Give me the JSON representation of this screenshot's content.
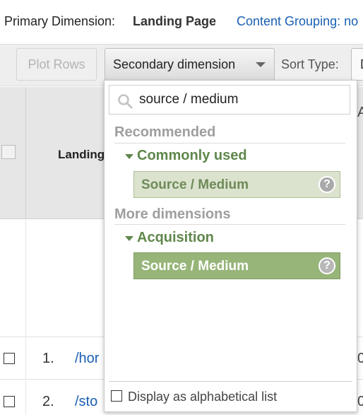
{
  "dimension_bar": {
    "primary_label": "Primary Dimension:",
    "primary_value": "Landing Page",
    "content_grouping": "Content Grouping: no"
  },
  "toolbar": {
    "plot_rows": "Plot Rows",
    "secondary_dimension": "Secondary dimension",
    "sort_type_label": "Sort Type:",
    "sort_type_value": "D"
  },
  "table": {
    "header_label": "Landing",
    "header_right_fragment": "A",
    "rows": [
      {
        "num": "1.",
        "link": "/hor",
        "right": "0"
      },
      {
        "num": "2.",
        "link": "/sto",
        "right": "0"
      }
    ]
  },
  "dropdown": {
    "search_value": "source / medium",
    "recommended_title": "Recommended",
    "commonly_used_title": "Commonly used",
    "commonly_used_item": "Source / Medium",
    "more_dimensions_title": "More dimensions",
    "acquisition_title": "Acquisition",
    "acquisition_item": "Source / Medium",
    "help_glyph": "?",
    "alphabetical_label": "Display as alphabetical list"
  },
  "colors": {
    "group_green": "#5f874b",
    "item_light_bg": "#dbe3cf",
    "item_dark_bg": "#97b579",
    "link_blue": "#1a5fb4"
  }
}
